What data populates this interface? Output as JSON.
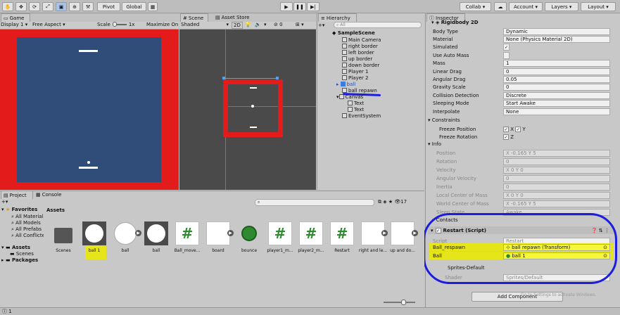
{
  "toolbar": {
    "pivot": "Pivot",
    "global": "Global",
    "collab": "Collab",
    "account": "Account",
    "layers": "Layers",
    "layout": "Layout"
  },
  "game": {
    "tab": "Game",
    "display": "Display 1",
    "aspect": "Free Aspect",
    "scale_label": "Scale",
    "scale_value": "1x",
    "maximize": "Maximize On Pl"
  },
  "scene": {
    "tab": "Scene",
    "asset_store_tab": "Asset Store",
    "shading": "Shaded",
    "mode_2d": "2D",
    "layer_count": "0"
  },
  "hierarchy": {
    "tab": "Hierarchy",
    "search_placeholder": "All",
    "items": [
      "SampleScene",
      "Main Camera",
      "right border",
      "left border",
      "up border",
      "down border",
      "Player 1",
      "Player 2",
      "ball",
      "ball repawn",
      "Canvas",
      "Text",
      "Text",
      "EventSystem"
    ]
  },
  "inspector": {
    "tab": "Inspector",
    "component": "Rigidbody 2D",
    "rows": [
      {
        "label": "Body Type",
        "value": "Dynamic"
      },
      {
        "label": "Material",
        "value": "None (Physics Material 2D)"
      },
      {
        "label": "Simulated",
        "value": "✓"
      },
      {
        "label": "Use Auto Mass",
        "value": ""
      },
      {
        "label": "Mass",
        "value": "1"
      },
      {
        "label": "Linear Drag",
        "value": "0"
      },
      {
        "label": "Angular Drag",
        "value": "0.05"
      },
      {
        "label": "Gravity Scale",
        "value": "0"
      },
      {
        "label": "Collision Detection",
        "value": "Discrete"
      },
      {
        "label": "Sleeping Mode",
        "value": "Start Awake"
      },
      {
        "label": "Interpolate",
        "value": "None"
      }
    ],
    "constraints": "Constraints",
    "freeze_position": "Freeze Position",
    "freeze_rotation": "Freeze Rotation",
    "fx": "X",
    "fy": "Y",
    "fz": "Z",
    "info": "Info",
    "info_rows": [
      {
        "label": "Position",
        "value": "X -0.165    Y 5"
      },
      {
        "label": "Rotation",
        "value": "0"
      },
      {
        "label": "Velocity",
        "value": "X 0        Y 0"
      },
      {
        "label": "Angular Velocity",
        "value": "0"
      },
      {
        "label": "Inertia",
        "value": "0"
      },
      {
        "label": "Local Center of Mass",
        "value": "X 0        Y 0"
      },
      {
        "label": "World Center of Mass",
        "value": "X -0.165    Y 5"
      },
      {
        "label": "Sleep State",
        "value": "Awake"
      }
    ],
    "contacts": "Contacts",
    "restart": {
      "title": "Restart (Script)",
      "script_label": "Script",
      "script_value": "Restart",
      "respawn_label": "Ball_respawn",
      "respawn_value": "ball repawn (Transform)",
      "ball_label": "Ball",
      "ball_value": "ball 1"
    },
    "sprites_default": "Sprites-Default",
    "shader_label": "Shader",
    "shader_value": "Sprites/Default",
    "add_component": "Add Component",
    "watermark": "Go to Settings to activate Windows."
  },
  "project": {
    "tab": "Project",
    "console_tab": "Console",
    "favorites": "Favorites",
    "fav_items": [
      "All Materials",
      "All Models",
      "All Prefabs",
      "All Conflicted"
    ],
    "assets_root": "Assets",
    "scenes": "Scenes",
    "packages": "Packages",
    "breadcrumb": "Assets",
    "count": "17",
    "assets": [
      "Scenes",
      "ball 1",
      "ball",
      "ball",
      "Ball_move...",
      "board",
      "bounce",
      "player1_m...",
      "player2_m...",
      "Restart",
      "right and le...",
      "up and do..."
    ]
  },
  "status": {
    "errors": "1"
  }
}
